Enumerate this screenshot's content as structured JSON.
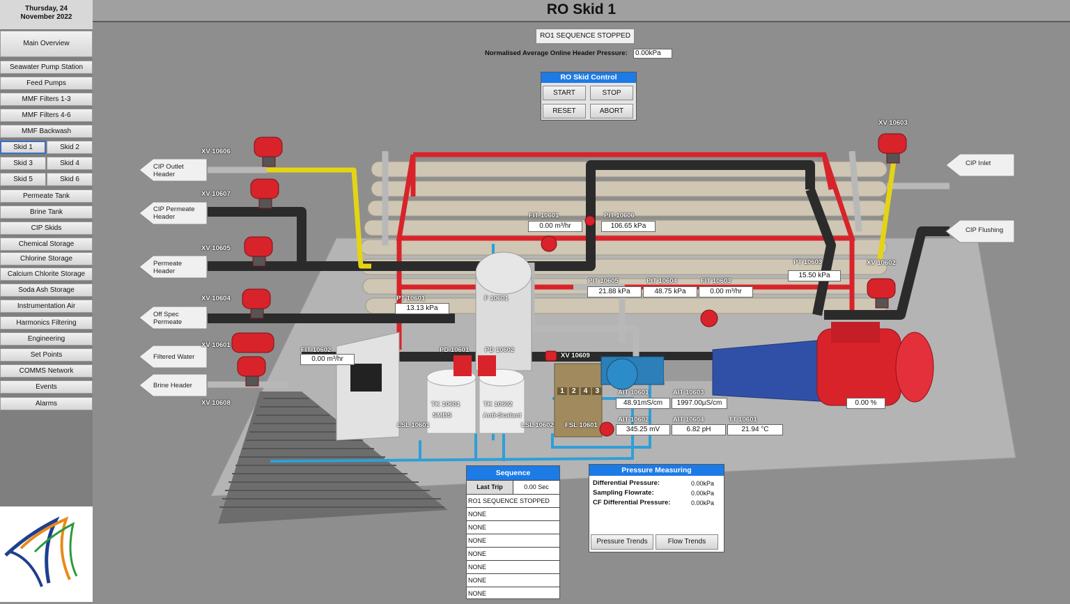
{
  "date": {
    "line1": "Thursday, 24",
    "line2": "November 2022"
  },
  "title": "RO Skid 1",
  "nav": {
    "main_overview": "Main Overview",
    "items": [
      "Seawater Pump Station",
      "Feed Pumps",
      "MMF Filters 1-3",
      "MMF Filters 4-6",
      "MMF Backwash"
    ],
    "skids": [
      "Skid 1",
      "Skid 2",
      "Skid 3",
      "Skid 4",
      "Skid 5",
      "Skid 6"
    ],
    "items2": [
      "Permeate Tank",
      "Brine Tank",
      "CIP Skids",
      "Chemical Storage",
      "Chlorine Storage",
      "Calcium Chlorite Storage",
      "Soda Ash Storage",
      "Instrumentation Air",
      "Harmonics Filtering",
      "Engineering",
      "Set Points",
      "COMMS Network",
      "Events",
      "Alarms"
    ]
  },
  "status": {
    "sequence_state": "RO1 SEQUENCE STOPPED",
    "header_pressure_label": "Normalised Average Online Header Pressure:",
    "header_pressure_value": "0.00kPa"
  },
  "control": {
    "title": "RO Skid Control",
    "start": "START",
    "stop": "STOP",
    "reset": "RESET",
    "abort": "ABORT"
  },
  "headers": {
    "cip_outlet": [
      "CIP Outlet",
      "Header"
    ],
    "cip_permeate": [
      "CIP Permeate",
      "Header"
    ],
    "permeate": [
      "Permeate",
      "Header"
    ],
    "off_spec": [
      "Off Spec",
      "Permeate"
    ],
    "filtered_water": "Filtered Water",
    "brine": "Brine Header",
    "cip_inlet": "CIP Inlet",
    "cip_flushing": "CIP Flushing"
  },
  "valves": {
    "xv10606": "XV 10606",
    "xv10607": "XV 10607",
    "xv10605": "XV 10605",
    "xv10604": "XV 10604",
    "xv10601": "XV 10601",
    "xv10608": "XV 10608",
    "xv10603": "XV 10603",
    "xv10602": "XV 10602",
    "xv10609": "XV 10609"
  },
  "instruments": {
    "fit10601": {
      "tag": "FIT 10601",
      "value": "0.00 m³/hr"
    },
    "pit10606": {
      "tag": "PIT 10606",
      "value": "106.65 kPa"
    },
    "pit10605": {
      "tag": "PIT 10605",
      "value": "21.88 kPa"
    },
    "pit10604": {
      "tag": "PIT 10604",
      "value": "48.75 kPa"
    },
    "fit10603": {
      "tag": "FIT 10603",
      "value": "0.00 m³/hr"
    },
    "pt10603": {
      "tag": "PT 10603",
      "value": "15.50 kPa"
    },
    "pt10601": {
      "tag": "PT 10601",
      "value": "13.13 kPa"
    },
    "fit10602": {
      "tag": "FIT 10602",
      "value": "0.00 m³/hr"
    },
    "ait10601": {
      "tag": "AIT 10601",
      "value": "48.91mS/cm"
    },
    "ait10603": {
      "tag": "AIT 10603",
      "value": "1997.00µS/cm"
    },
    "ait10602": {
      "tag": "AIT 10602",
      "value": "345.25 mV"
    },
    "ait10604": {
      "tag": "AIT 10604",
      "value": "6.82 pH"
    },
    "tt10601": {
      "tag": "TT 10601",
      "value": "21.94 °C"
    },
    "pump_speed": "0.00 %"
  },
  "equipment": {
    "f10601": "F 10601",
    "pd10601": "PD 10601",
    "pd10602": "PD 10602",
    "tk10601": "TK 10601",
    "tk10601_sub": "SMBS",
    "tk10602": "TK 10602",
    "tk10602_sub": "Anti-Scalant",
    "lsl10601": "LSL 10601",
    "lsl10602": "LSL 10602",
    "fsl10601": "FSL 10601",
    "cartridges": [
      "1",
      "2",
      "4",
      "3"
    ]
  },
  "sequence": {
    "title": "Sequence",
    "last_trip_label": "Last Trip",
    "last_trip_value": "0.00 Sec",
    "rows": [
      "RO1 SEQUENCE STOPPED",
      "NONE",
      "NONE",
      "NONE",
      "NONE",
      "NONE",
      "NONE",
      "NONE"
    ]
  },
  "pressure": {
    "title": "Pressure Measuring",
    "rows": [
      {
        "label": "Differential Pressure:",
        "value": "0.00kPa"
      },
      {
        "label": "Sampling Flowrate:",
        "value": "0.00kPa"
      },
      {
        "label": "CF Differential Pressure:",
        "value": "0.00kPa"
      }
    ],
    "pressure_trends": "Pressure Trends",
    "flow_trends": "Flow Trends"
  },
  "colors": {
    "accent": "#1d7be6",
    "valve": "#d8232a",
    "frame": "#d8232a",
    "pipe_dark": "#2b2b2b",
    "pipe_yellow": "#e4d414",
    "pipe_blue": "#2f9fd8"
  }
}
